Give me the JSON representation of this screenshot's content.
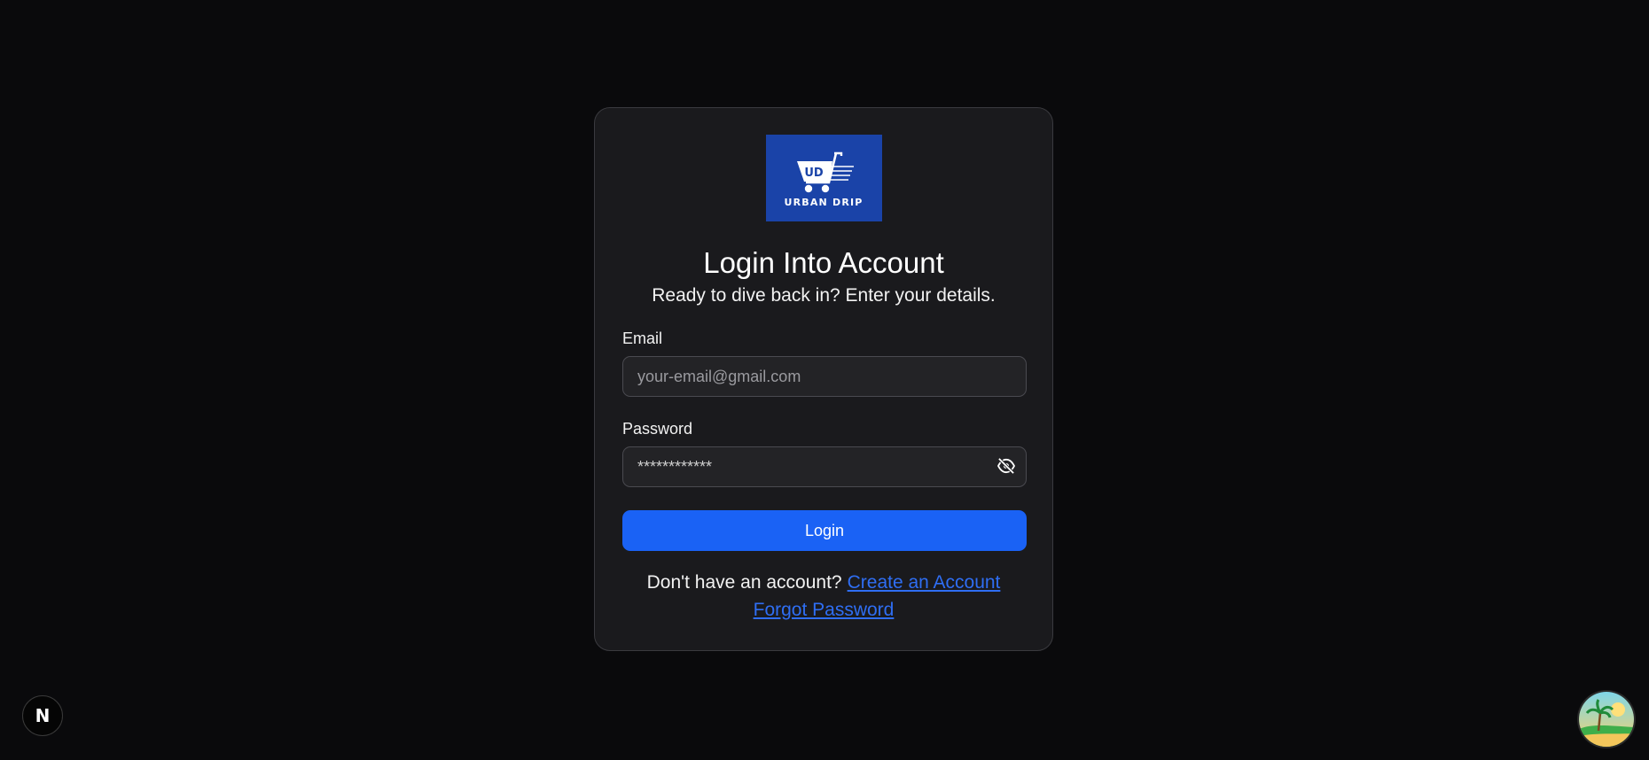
{
  "logo": {
    "monogram": "UD",
    "brand": "URBAN DRIP",
    "icon": "shopping-cart-icon",
    "background": "#1a43a8"
  },
  "header": {
    "title": "Login Into Account",
    "subtitle": "Ready to dive back in? Enter your details."
  },
  "form": {
    "email": {
      "label": "Email",
      "placeholder": "your-email@gmail.com",
      "value": ""
    },
    "password": {
      "label": "Password",
      "value": "************",
      "toggle_icon": "eye-off-icon"
    },
    "submit_label": "Login",
    "accent_color": "#1a62f5"
  },
  "footer": {
    "no_account_text": "Don't have an account?",
    "create_account_link": "Create an Account",
    "forgot_password_link": "Forgot Password",
    "link_color": "#2f6ef3"
  },
  "dev_badge": {
    "letter": "N",
    "icon": "nextjs-icon"
  },
  "avatar": {
    "icon": "beach-avatar-icon"
  }
}
